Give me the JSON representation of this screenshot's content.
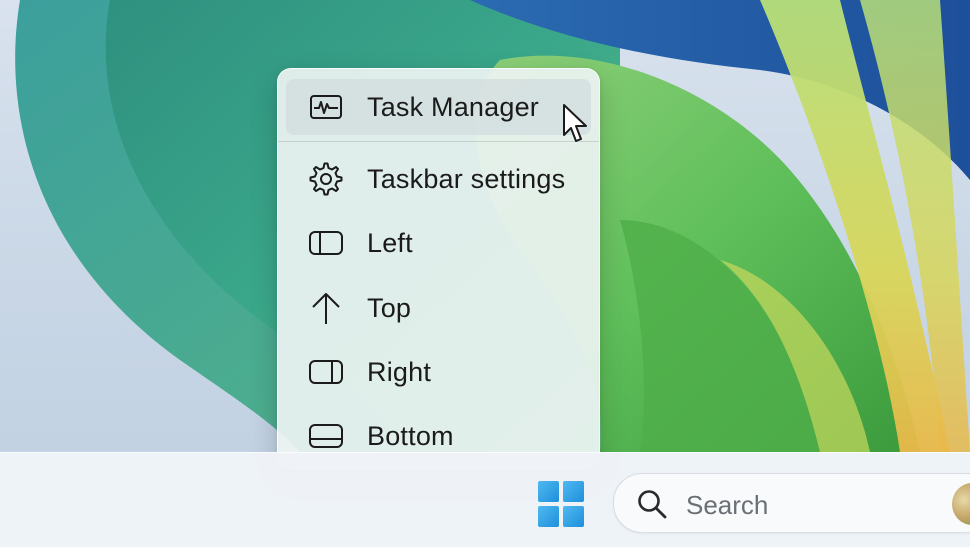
{
  "context_menu": {
    "items": [
      {
        "label": "Task Manager",
        "icon": "task-manager-icon",
        "highlighted": true
      },
      {
        "label": "Taskbar settings",
        "icon": "gear-icon"
      },
      {
        "label": "Left",
        "icon": "align-left-icon"
      },
      {
        "label": "Top",
        "icon": "arrow-up-icon"
      },
      {
        "label": "Right",
        "icon": "align-right-icon"
      },
      {
        "label": "Bottom",
        "icon": "align-bottom-icon"
      }
    ]
  },
  "taskbar": {
    "start_icon": "windows-logo-icon",
    "search": {
      "placeholder": "Search",
      "icon": "search-icon"
    }
  },
  "colors": {
    "menu_background": "#ecf3f2",
    "highlight": "#d2dcde",
    "start_blue": "#1f8fdc"
  }
}
